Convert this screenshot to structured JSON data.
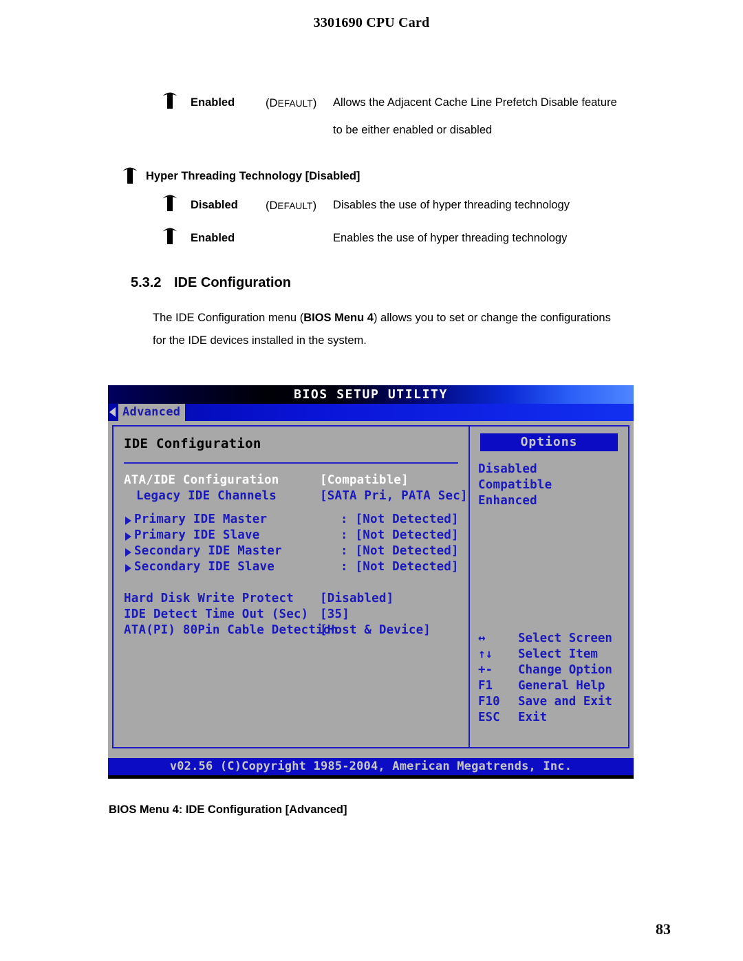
{
  "header": {
    "title": "3301690 CPU Card"
  },
  "top_option": {
    "label": "Enabled",
    "default_tag_open": "(",
    "default_tag": "DEFAULT",
    "default_tag_close": ")",
    "description_line1": "Allows the Adjacent Cache Line Prefetch Disable feature",
    "description_line2": "to be either enabled or disabled"
  },
  "hyper_threading": {
    "heading": "Hyper Threading Technology [Disabled]",
    "options": [
      {
        "label": "Disabled",
        "default_tag_open": "(",
        "default_tag": "DEFAULT",
        "default_tag_close": ")",
        "description": "Disables the use of hyper threading technology"
      },
      {
        "label": "Enabled",
        "default_tag_open": "",
        "default_tag": "",
        "default_tag_close": "",
        "description": "Enables the use of hyper threading technology"
      }
    ]
  },
  "section": {
    "number": "5.3.2",
    "title": "IDE Configuration",
    "body_line1_a": "The IDE Configuration menu (",
    "body_line1_b": "BIOS Menu 4",
    "body_line1_c": ") allows you to set or change the configurations",
    "body_line2": "for the IDE devices installed in the system."
  },
  "bios": {
    "title": "BIOS SETUP UTILITY",
    "tab": "Advanced",
    "panel_title": "IDE Configuration",
    "rows": [
      {
        "label": "ATA/IDE Configuration",
        "value": "[Compatible]",
        "style": "white",
        "arrow": false
      },
      {
        "label": "Legacy IDE Channels",
        "value": "[SATA Pri, PATA Sec]",
        "style": "blue",
        "arrow": false
      },
      {
        "label": "Primary IDE Master",
        "value": ": [Not Detected]",
        "style": "blue",
        "arrow": true
      },
      {
        "label": "Primary IDE Slave",
        "value": ": [Not Detected]",
        "style": "blue",
        "arrow": true
      },
      {
        "label": "Secondary IDE Master",
        "value": ": [Not Detected]",
        "style": "blue",
        "arrow": true
      },
      {
        "label": "Secondary IDE Slave",
        "value": ": [Not Detected]",
        "style": "blue",
        "arrow": true
      },
      {
        "label": "Hard Disk Write Protect",
        "value": "[Disabled]",
        "style": "blue",
        "arrow": false
      },
      {
        "label": "IDE Detect Time Out (Sec)",
        "value": "[35]",
        "style": "blue",
        "arrow": false
      },
      {
        "label": "ATA(PI) 80Pin Cable Detection",
        "value": "[Host & Device]",
        "style": "blue",
        "arrow": false
      }
    ],
    "options_header": "Options",
    "options": [
      "Disabled",
      "Compatible",
      "Enhanced"
    ],
    "keys": [
      {
        "key": "↔",
        "desc": "Select Screen"
      },
      {
        "key": "↑↓",
        "desc": "Select Item"
      },
      {
        "key": "+-",
        "desc": "Change Option"
      },
      {
        "key": "F1",
        "desc": "General Help"
      },
      {
        "key": "F10",
        "desc": "Save and Exit"
      },
      {
        "key": "ESC",
        "desc": "Exit"
      }
    ],
    "footer": "v02.56 (C)Copyright 1985-2004, American Megatrends, Inc.",
    "colors": {
      "panel_bg": "#a8a8a8",
      "border_blue": "#1a1ac0",
      "text_blue": "#1a1aba",
      "bar_blue": "#0c0cc4",
      "text_white": "#ffffff"
    }
  },
  "caption": "BIOS Menu 4: IDE Configuration [Advanced]",
  "page_number": "83"
}
